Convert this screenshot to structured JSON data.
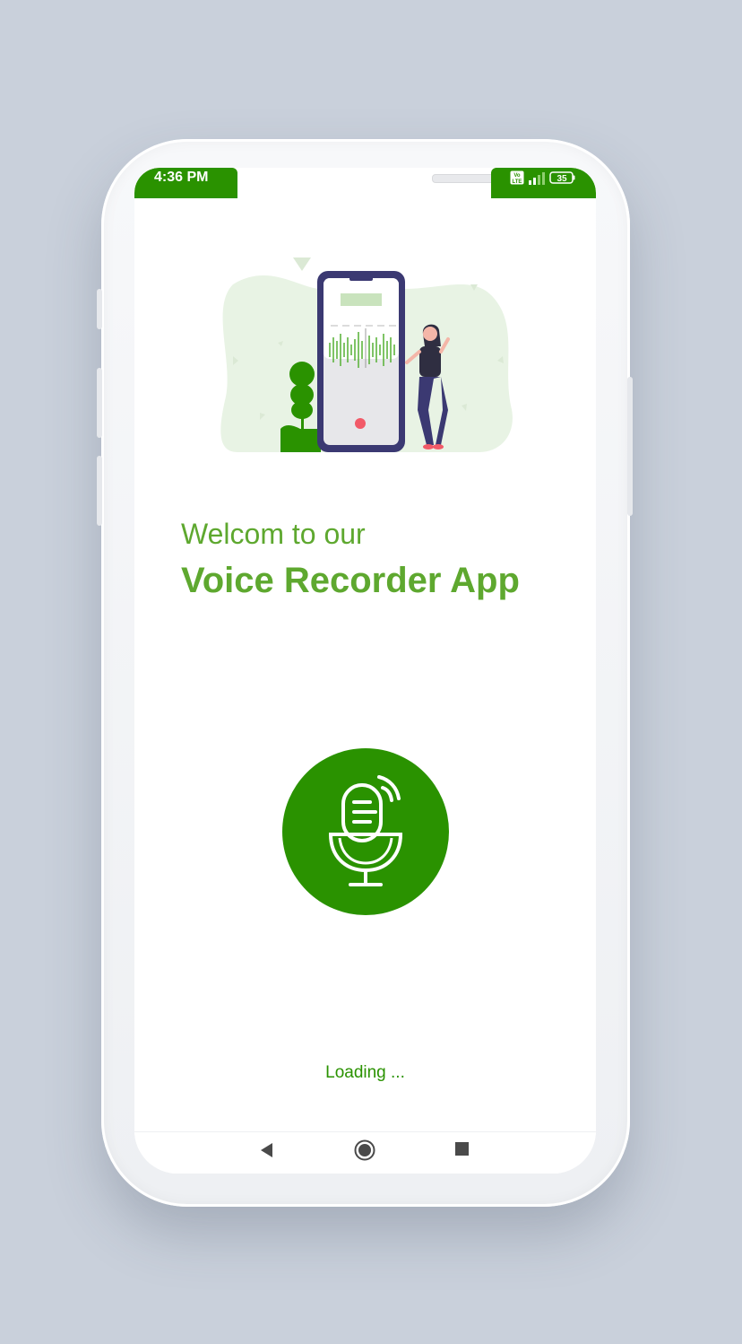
{
  "status_bar": {
    "time": "4:36 PM",
    "volte_label": "Vo LTE",
    "battery": "35",
    "color": "#2a9200"
  },
  "welcome": {
    "line1": "Welcom to our",
    "line2": "Voice Recorder App",
    "color": "#5ea82f"
  },
  "mic_button": {
    "icon": "microphone-icon",
    "color": "#2a9200"
  },
  "loading_text": "Loading ...",
  "nav": {
    "back_icon": "back-triangle-icon",
    "home_icon": "home-circle-icon",
    "recents_icon": "recents-square-icon"
  }
}
